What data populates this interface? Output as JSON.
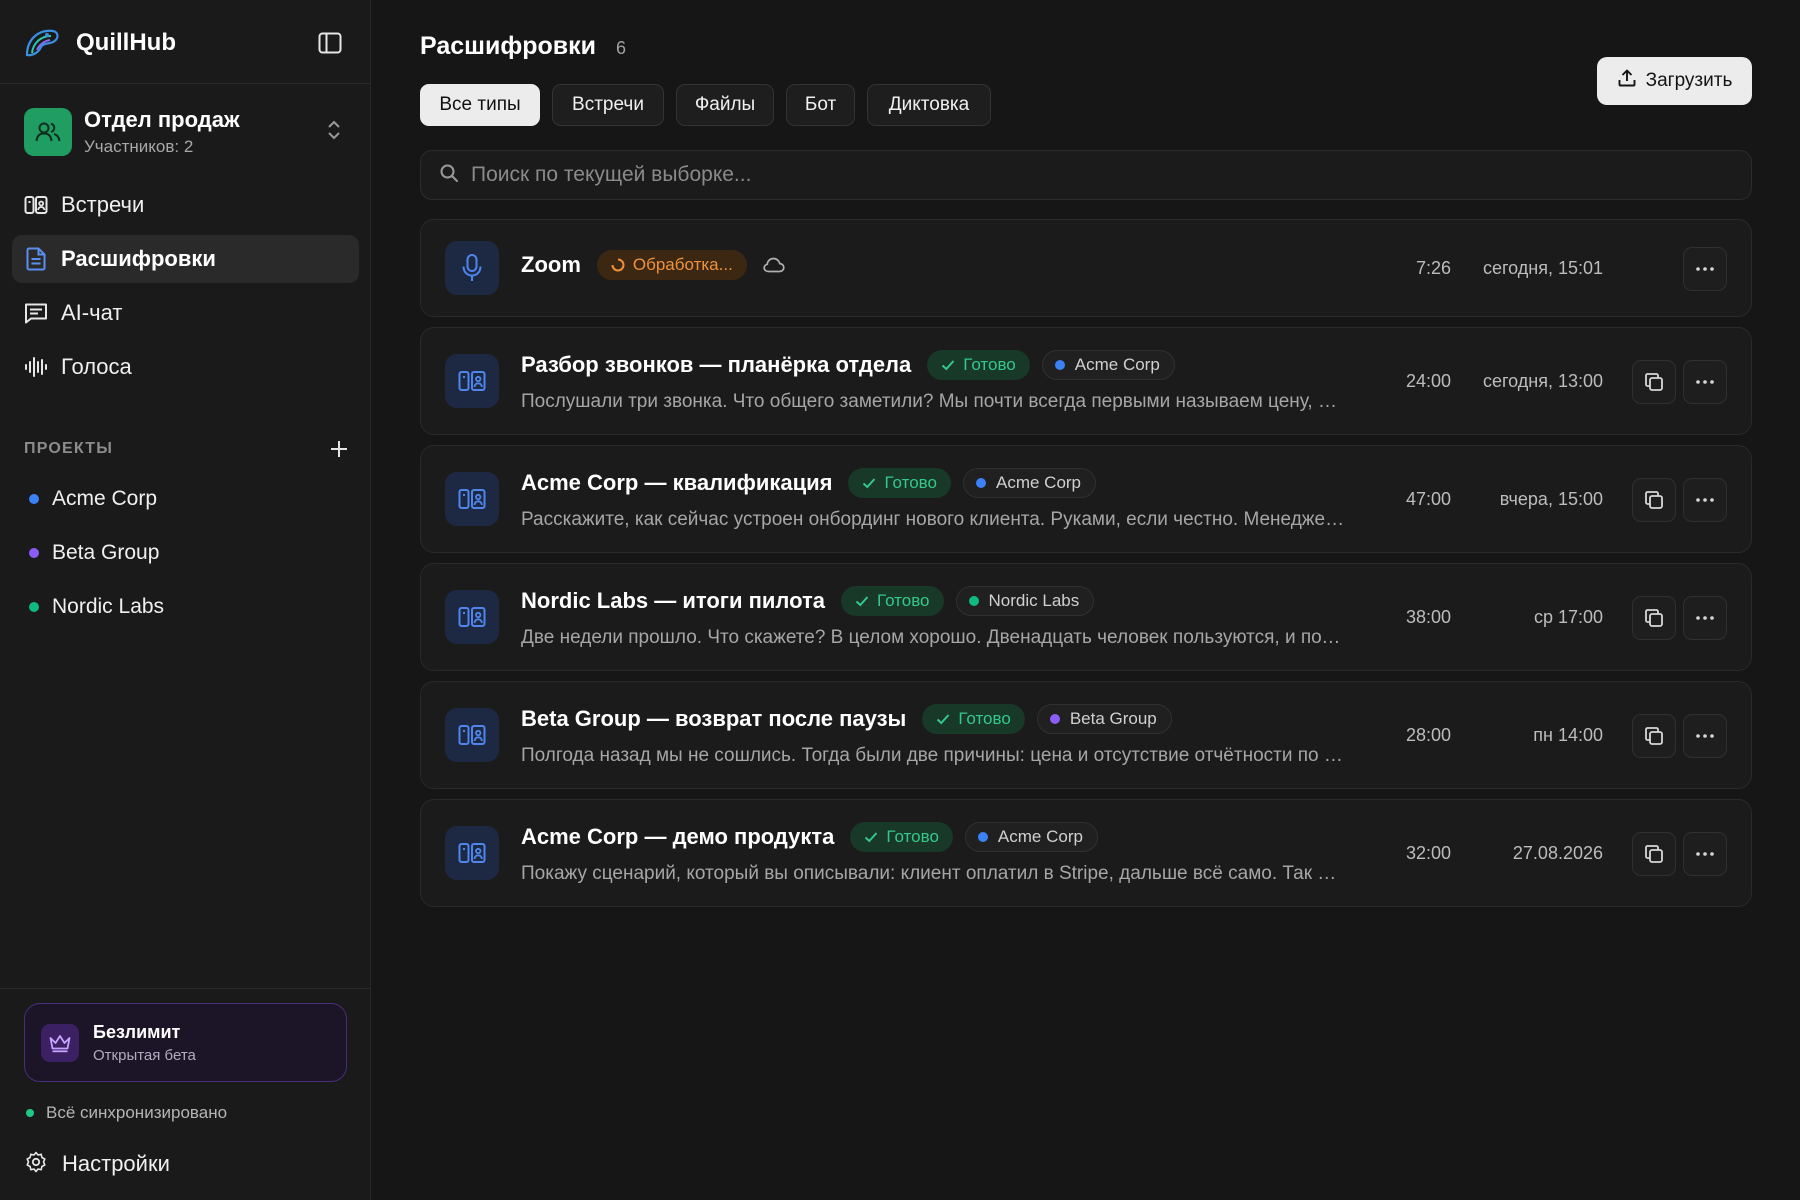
{
  "app": {
    "name": "QuillHub"
  },
  "workspace": {
    "name": "Отдел продаж",
    "members": "Участников: 2"
  },
  "nav": [
    {
      "id": "meetings",
      "label": "Встречи",
      "icon": "meeting-icon",
      "active": false
    },
    {
      "id": "transcripts",
      "label": "Расшифровки",
      "icon": "document-icon",
      "active": true
    },
    {
      "id": "ai-chat",
      "label": "AI-чат",
      "icon": "chat-icon",
      "active": false
    },
    {
      "id": "voices",
      "label": "Голоса",
      "icon": "waveform-icon",
      "active": false
    }
  ],
  "projects_header": "ПРОЕКТЫ",
  "projects": [
    {
      "label": "Acme Corp",
      "color": "#3b82f6"
    },
    {
      "label": "Beta Group",
      "color": "#8b5cf6"
    },
    {
      "label": "Nordic Labs",
      "color": "#10b981"
    }
  ],
  "plan": {
    "title": "Безлимит",
    "subtitle": "Открытая бета"
  },
  "sync_status": "Всё синхронизировано",
  "settings_label": "Настройки",
  "page": {
    "title": "Расшифровки",
    "count": "6",
    "upload_label": "Загрузить"
  },
  "tabs": [
    {
      "label": "Все типы",
      "active": true
    },
    {
      "label": "Встречи",
      "active": false
    },
    {
      "label": "Файлы",
      "active": false
    },
    {
      "label": "Бот",
      "active": false
    },
    {
      "label": "Диктовка",
      "active": false
    }
  ],
  "search": {
    "placeholder": "Поиск по текущей выборке...",
    "value": ""
  },
  "transcripts": [
    {
      "title": "Zoom",
      "status": "Обработка...",
      "status_kind": "processing",
      "source_icon": "microphone-icon",
      "cloud": true,
      "project": null,
      "project_color": null,
      "snippet": "",
      "duration": "7:26",
      "date": "сегодня, 15:01",
      "copy": false
    },
    {
      "title": "Разбор звонков — планёрка отдела",
      "status": "Готово",
      "status_kind": "ready",
      "source_icon": "meeting-icon",
      "cloud": false,
      "project": "Acme Corp",
      "project_color": "#3b82f6",
      "snippet": "Послушали три звонка. Что общего заметили? Мы почти всегда первыми называем цену, ещё до того как клиент понял ценность.",
      "duration": "24:00",
      "date": "сегодня, 13:00",
      "copy": true
    },
    {
      "title": "Acme Corp — квалификация",
      "status": "Готово",
      "status_kind": "ready",
      "source_icon": "meeting-icon",
      "cloud": false,
      "project": "Acme Corp",
      "project_color": "#3b82f6",
      "snippet": "Расскажите, как сейчас устроен онбординг нового клиента. Руками, если честно. Менеджер собирает всё вручную.",
      "duration": "47:00",
      "date": "вчера, 15:00",
      "copy": true
    },
    {
      "title": "Nordic Labs — итоги пилота",
      "status": "Готово",
      "status_kind": "ready",
      "source_icon": "meeting-icon",
      "cloud": false,
      "project": "Nordic Labs",
      "project_color": "#10b981",
      "snippet": "Две недели прошло. Что скажете? В целом хорошо. Двенадцать человек пользуются, и почти никто не жалуется.",
      "duration": "38:00",
      "date": "ср 17:00",
      "copy": true
    },
    {
      "title": "Beta Group — возврат после паузы",
      "status": "Готово",
      "status_kind": "ready",
      "source_icon": "meeting-icon",
      "cloud": false,
      "project": "Beta Group",
      "project_color": "#8b5cf6",
      "snippet": "Полгода назад мы не сошлись. Тогда были две причины: цена и отсутствие отчётности по командам.",
      "duration": "28:00",
      "date": "пн 14:00",
      "copy": true
    },
    {
      "title": "Acme Corp — демо продукта",
      "status": "Готово",
      "status_kind": "ready",
      "source_icon": "meeting-icon",
      "cloud": false,
      "project": "Acme Corp",
      "project_color": "#3b82f6",
      "snippet": "Покажу сценарий, который вы описывали: клиент оплатил в Stripe, дальше всё само. Так выглядит весь поток.",
      "duration": "32:00",
      "date": "27.08.2026",
      "copy": true
    }
  ]
}
